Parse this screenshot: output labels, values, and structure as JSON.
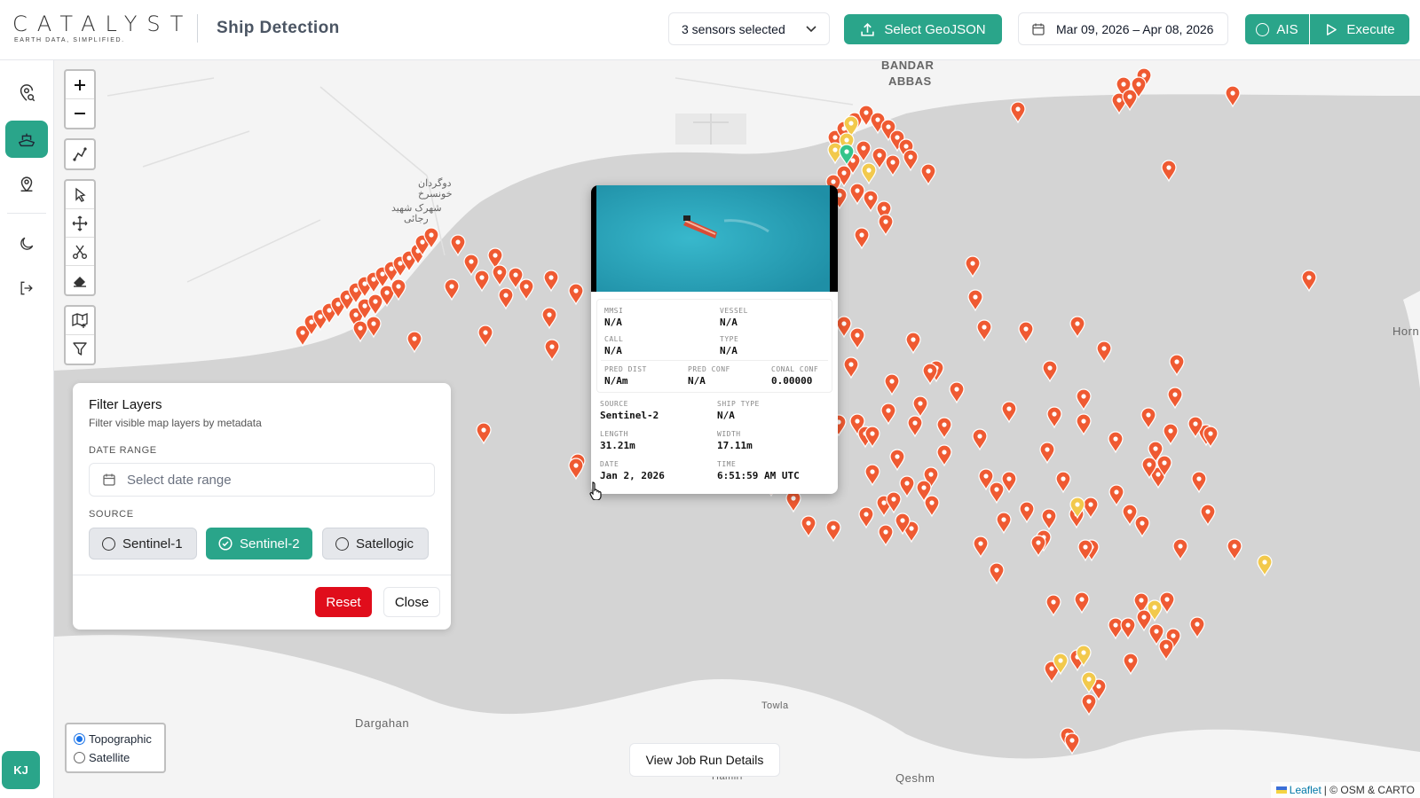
{
  "header": {
    "logo_word": "CATALYST",
    "logo_tagline": "EARTH DATA, SIMPLIFIED.",
    "title": "Ship Detection",
    "sensor_select": "3 sensors selected",
    "geojson_button": "Select GeoJSON",
    "date_range": "Mar 09, 2026 – Apr 08, 2026",
    "ais_button": "AIS",
    "execute_button": "Execute"
  },
  "user": {
    "initials": "KJ"
  },
  "map": {
    "places": {
      "bandar": "BANDAR",
      "abbas": "ABBAS",
      "farsi1": "دوگردان",
      "farsi2": "خونسرخ",
      "farsi3": "شهرک شهید",
      "farsi4": "رجائی",
      "horn": "Horn",
      "dargahan": "Dargahan",
      "towla": "Towla",
      "hamiri": "Hamiri",
      "qeshm": "Qeshm"
    },
    "attribution_link": "Leaflet",
    "attribution_text": "| © OSM & CARTO"
  },
  "filter": {
    "title": "Filter Layers",
    "subtitle": "Filter visible map layers by metadata",
    "date_label": "DATE RANGE",
    "date_placeholder": "Select date range",
    "source_label": "SOURCE",
    "sources": [
      "Sentinel-1",
      "Sentinel-2",
      "Satellogic"
    ],
    "selected_source": "Sentinel-2",
    "reset": "Reset",
    "close": "Close"
  },
  "popup": {
    "mmsi_k": "MMSI",
    "mmsi_v": "N/A",
    "vessel_k": "VESSEL",
    "vessel_v": "N/A",
    "call_k": "CALL",
    "call_v": "N/A",
    "type_k": "TYPE",
    "type_v": "N/A",
    "pred_dist_k": "PRED DIST",
    "pred_dist_v": "N/Am",
    "pred_conf_k": "PRED CONF",
    "pred_conf_v": "N/A",
    "conal_conf_k": "CONAL CONF",
    "conal_conf_v": "0.00000",
    "source_k": "SOURCE",
    "source_v": "Sentinel-2",
    "ship_type_k": "SHIP TYPE",
    "ship_type_v": "N/A",
    "length_k": "LENGTH",
    "length_v": "31.21m",
    "width_k": "WIDTH",
    "width_v": "17.11m",
    "date_k": "DATE",
    "date_v": "Jan 2, 2026",
    "time_k": "TIME",
    "time_v": "6:51:59 AM UTC"
  },
  "base_layers": {
    "topographic": "Topographic",
    "satellite": "Satellite",
    "selected": "Topographic"
  },
  "view_job_button": "View Job Run Details",
  "colors": {
    "accent": "#2aa58a",
    "marker_red": "#ef5a32",
    "marker_yellow": "#f2c94c",
    "marker_green": "#34c48b",
    "danger": "#e00d1b"
  }
}
